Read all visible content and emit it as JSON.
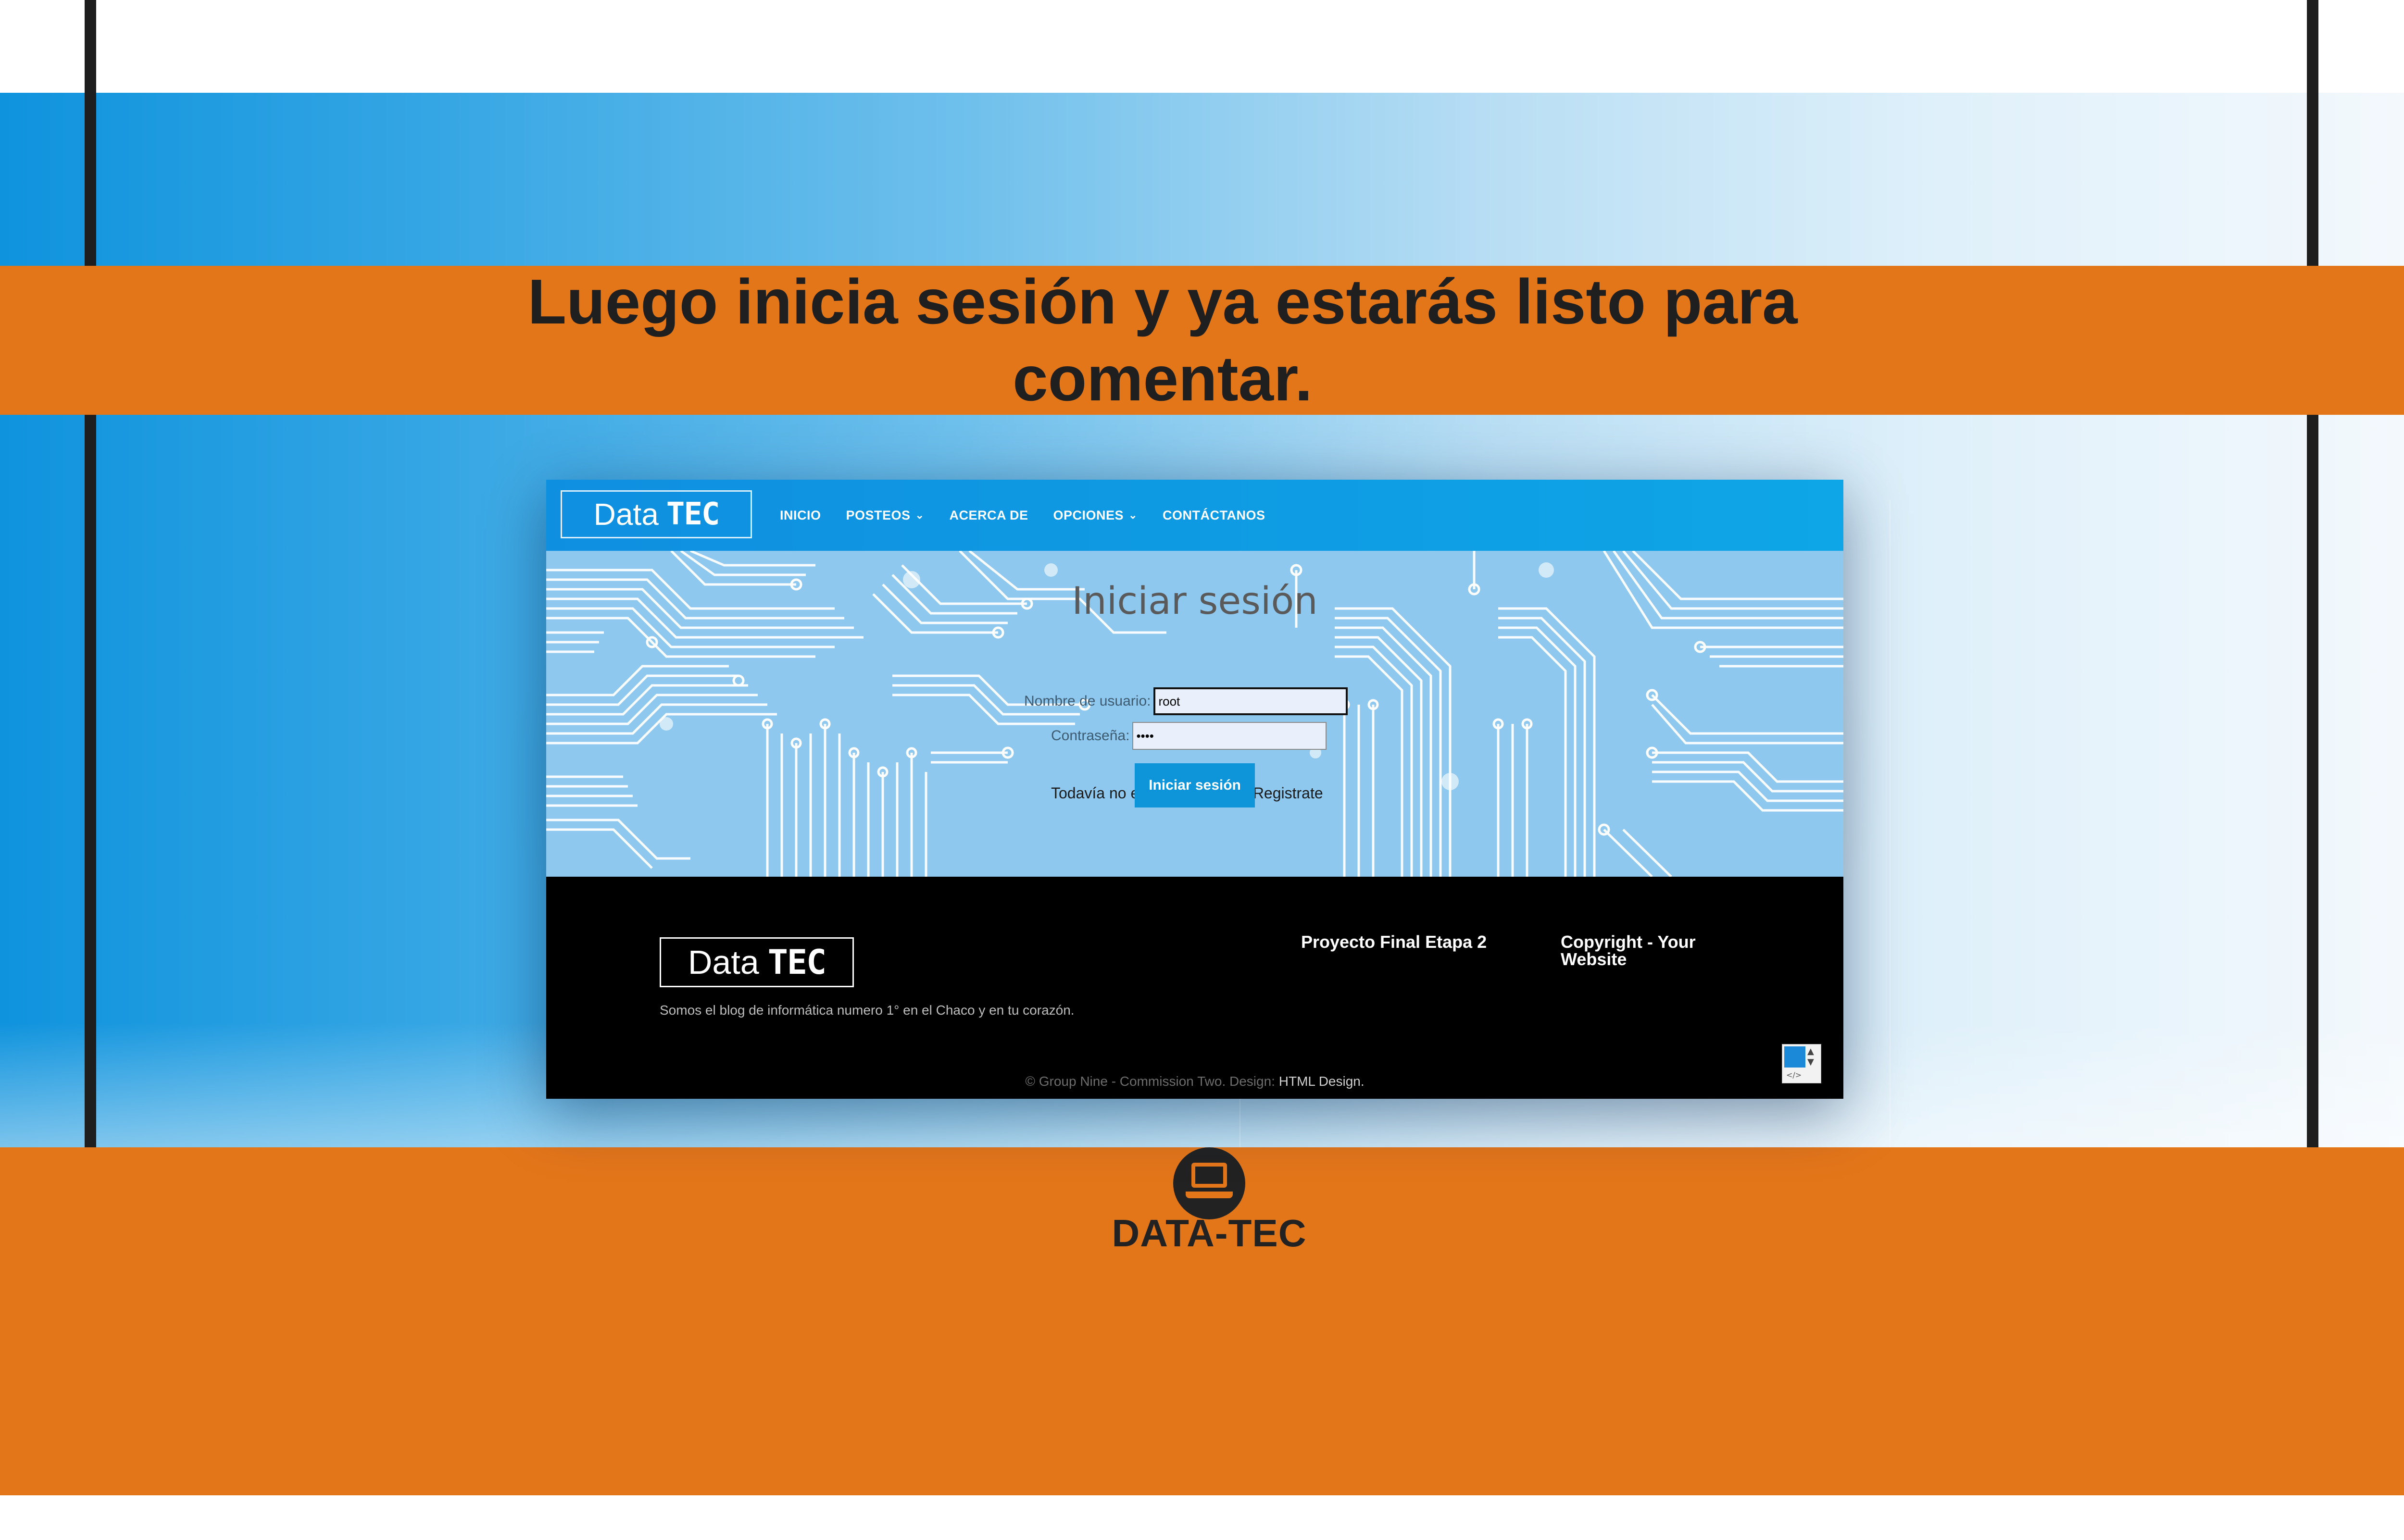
{
  "headline": "Luego inicia sesión y ya estarás listo para comentar.",
  "brand": {
    "name": "DATA-TEC",
    "icon": "laptop-icon"
  },
  "colors": {
    "band": "#e4761a",
    "nav": "#0f8fe0",
    "hero": "#8ec8ee",
    "button": "#0e94d8"
  },
  "site": {
    "logo": {
      "light": "Data",
      "strong": "TEC"
    },
    "nav": [
      {
        "label": "INICIO",
        "dropdown": false
      },
      {
        "label": "POSTEOS",
        "dropdown": true
      },
      {
        "label": "ACERCA DE",
        "dropdown": false
      },
      {
        "label": "OPCIONES",
        "dropdown": true
      },
      {
        "label": "CONTÁCTANOS",
        "dropdown": false
      }
    ],
    "login": {
      "title": "Iniciar sesión",
      "username_label": "Nombre de usuario:",
      "username_value": "root",
      "password_label": "Contraseña:",
      "password_value": "••••",
      "register_text": "Todavía no estás registrado?",
      "register_link": "Registrate",
      "button": "Iniciar sesión"
    },
    "footer": {
      "description": "Somos el blog de informática numero 1° en el Chaco y en tu corazón.",
      "col1": "Proyecto Final Etapa 2",
      "col2": "Copyright - Your Website",
      "copyright": "© Group Nine - Commission Two. Design:",
      "design_link": "HTML Design."
    }
  }
}
